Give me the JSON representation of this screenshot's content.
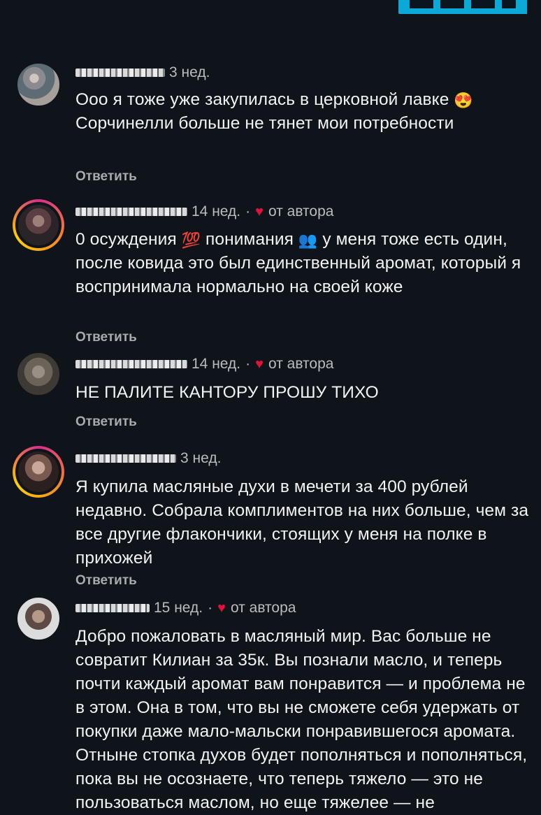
{
  "comments": [
    {
      "time": "3 нед.",
      "by_author": false,
      "author_label": "",
      "text_parts": [
        "Ооо я тоже уже закупилась в церковной лавке ",
        "😍",
        " Сорчинелли больше не тянет мои потребности"
      ],
      "reply": "Ответить"
    },
    {
      "time": "14 нед.",
      "by_author": true,
      "author_label": "от автора",
      "text_parts": [
        "0 осуждения ",
        "💯",
        " понимания ",
        "👥",
        " у меня тоже есть один, после ковида это был единственный аромат, который я воспринимала нормально на своей коже"
      ],
      "reply": "Ответить"
    },
    {
      "time": "14 нед.",
      "by_author": true,
      "author_label": "от автора",
      "text_parts": [
        "НЕ ПАЛИТЕ КАНТОРУ ПРОШУ ТИХО"
      ],
      "reply": "Ответить"
    },
    {
      "time": "3 нед.",
      "by_author": false,
      "author_label": "",
      "text_parts": [
        "Я купила масляные духи в мечети за 400 рублей недавно. Собрала комплиментов на них больше, чем за все другие флакончики, стоящих у меня на полке в прихожей"
      ],
      "reply": "Ответить"
    },
    {
      "time": "15 нед.",
      "by_author": true,
      "author_label": "от автора",
      "text_parts": [
        "Добро пожаловать в масляный мир. Вас больше не совратит Килиан за 35к. Вы познали масло, и теперь почти каждый аромат вам понравится — и проблема не в этом. Она в том, что вы не сможете себя удержать от покупки даже мало-мальски понравившегося аромата. Отныне стопка духов будет пополняться и пополняться, пока вы не осознаете, что теперь тяжело — это не пользоваться маслом, но еще тяжелее — не"
      ],
      "reply": ""
    }
  ],
  "meta_separator": "·",
  "colors": {
    "background": "#0e1419",
    "text": "#f3f3f3",
    "muted": "#b9bcc0",
    "heart": "#e0123a",
    "story_ring": "#d92e8b"
  },
  "icons": {
    "heart": "heart-icon",
    "emoji_1": "heart-eyes-emoji-icon",
    "emoji_2": "hundred-points-emoji-icon",
    "emoji_3": "busts-in-silhouette-emoji-icon"
  }
}
